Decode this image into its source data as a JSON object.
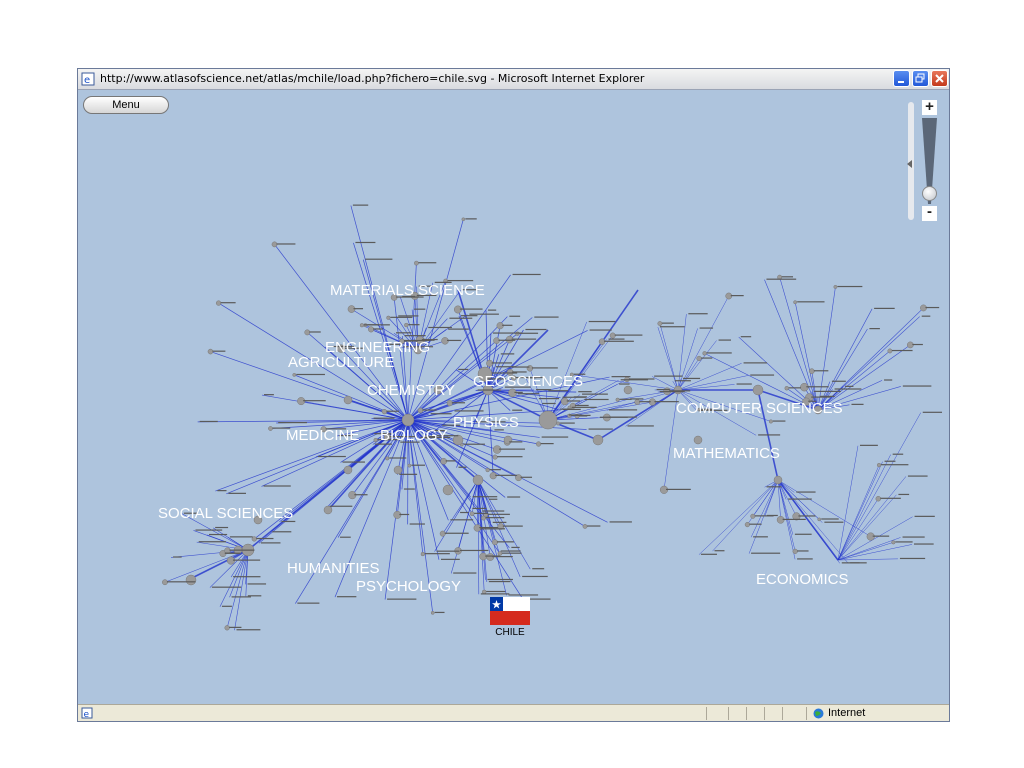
{
  "window": {
    "title": "http://www.atlasofscience.net/atlas/mchile/load.php?fichero=chile.svg - Microsoft Internet Explorer",
    "minimize_label": "_",
    "maximize_label": "restore",
    "close_label": "X"
  },
  "toolbar": {
    "menu_label": "Menu"
  },
  "zoom": {
    "plus_label": "+",
    "minus_label": "-"
  },
  "map": {
    "country_label": "CHILE",
    "categories": [
      "MATERIALS SCIENCE",
      "ENGINEERING",
      "AGRICULTURE",
      "CHEMISTRY",
      "GEOSCIENCES",
      "PHYSICS",
      "MEDICINE",
      "BIOLOGY",
      "COMPUTER SCIENCES",
      "MATHEMATICS",
      "SOCIAL SCIENCES",
      "HUMANITIES",
      "PSYCHOLOGY",
      "ECONOMICS"
    ],
    "colors": {
      "background": "#aec4dd",
      "link": "#2233cc",
      "node": "#9a9a9a",
      "label": "#ffffff"
    }
  },
  "statusbar": {
    "zone_label": "Internet"
  },
  "icons": [
    "ie-page-icon",
    "minimize-icon",
    "restore-icon",
    "close-icon",
    "plus-icon",
    "minus-icon",
    "chile-flag-icon",
    "globe-icon"
  ]
}
